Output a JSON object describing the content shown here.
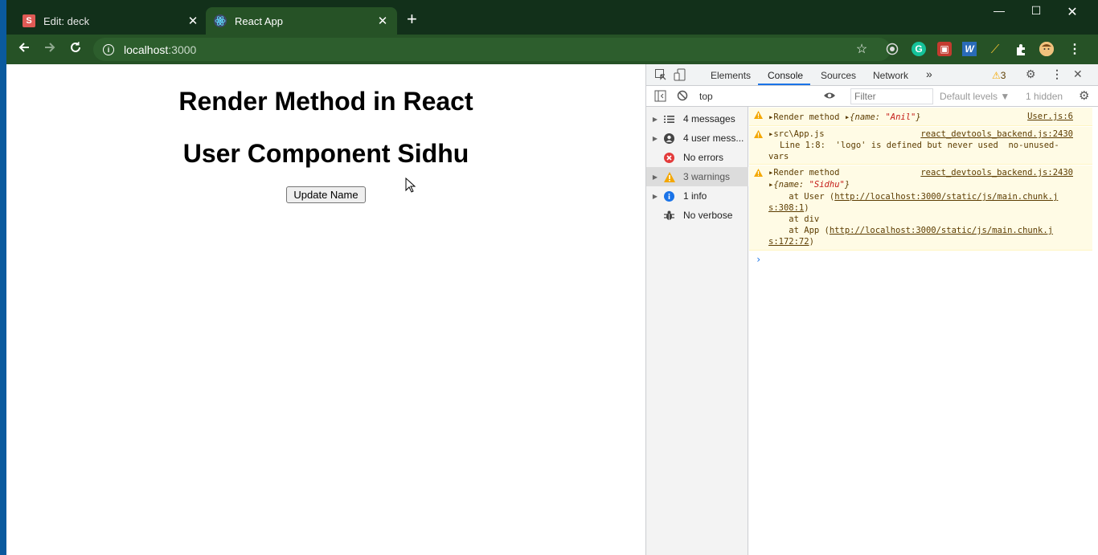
{
  "browser": {
    "tabs": [
      {
        "favicon": "S",
        "label": "Edit: deck",
        "active": false
      },
      {
        "favicon": "react-icon",
        "label": "React App",
        "active": true
      }
    ],
    "new_tab_label": "+",
    "url_host": "localhost",
    "url_port": ":3000",
    "window_controls": [
      "minimize-icon",
      "maximize-icon",
      "close-icon"
    ],
    "extensions": [
      "star-icon",
      "target-icon",
      "grammarly-icon",
      "extension-red-icon",
      "word-icon",
      "pencil-icon",
      "puzzle-icon",
      "profile-icon",
      "menu-icon"
    ]
  },
  "page": {
    "heading1": "Render Method in React",
    "heading2": "User Component Sidhu",
    "button_label": "Update Name"
  },
  "devtools": {
    "tabs": [
      "Elements",
      "Console",
      "Sources",
      "Network"
    ],
    "active_tab": "Console",
    "more_tabs": "»",
    "warning_count": "3",
    "context": "top",
    "filter_placeholder": "Filter",
    "levels_label": "Default levels ▼",
    "hidden_label": "1 hidden",
    "sidebar": [
      {
        "label": "4 messages",
        "icon": "list-icon"
      },
      {
        "label": "4 user mess...",
        "icon": "user-icon"
      },
      {
        "label": "No errors",
        "icon": "error-icon"
      },
      {
        "label": "3 warnings",
        "icon": "warning-icon"
      },
      {
        "label": "1 info",
        "icon": "info-icon"
      },
      {
        "label": "No verbose",
        "icon": "bug-icon"
      }
    ],
    "messages": [
      {
        "text": "Render method",
        "obj_key": "{name: ",
        "obj_val": "\"Anil\"",
        "obj_end": "}",
        "source": "User.js:6"
      },
      {
        "text": "src\\App.js",
        "detail1": "Line 1:8:  'logo' is defined but never used  no-unused-",
        "detail2": "vars",
        "source": "react_devtools_backend.js:2430"
      },
      {
        "text": "Render method",
        "obj_key": "{name: ",
        "obj_val": "\"Sidhu\"",
        "obj_end": "}",
        "stack1_prefix": "    at User (",
        "stack1_link": "http://localhost:3000/static/js/main.chunk.j",
        "stack1_cont": "s:308:1",
        "stack1_suffix": ")",
        "stack2": "    at div",
        "stack3_prefix": "    at App (",
        "stack3_link": "http://localhost:3000/static/js/main.chunk.j",
        "stack3_cont": "s:172:72",
        "stack3_suffix": ")",
        "source": "react_devtools_backend.js:2430"
      }
    ],
    "prompt": "›"
  }
}
